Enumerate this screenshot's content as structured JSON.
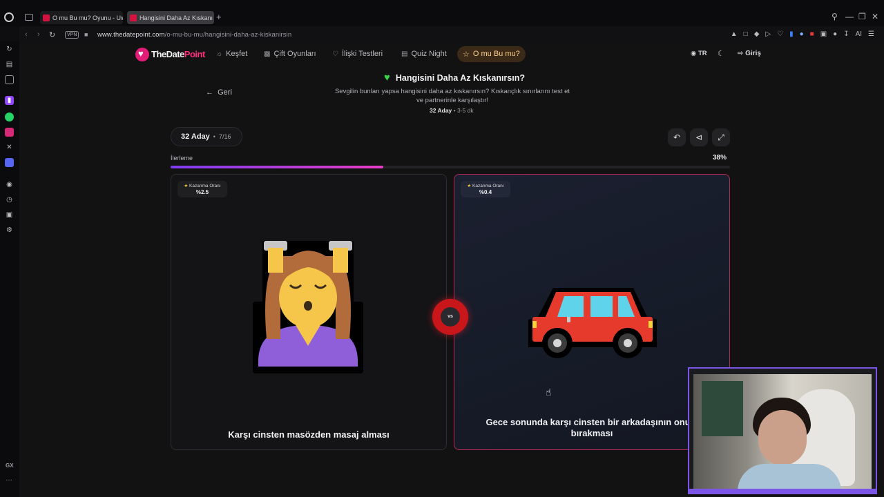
{
  "browser": {
    "tabs": [
      {
        "title": "O mu Bu mu? Oyunu - Uw",
        "active": false
      },
      {
        "title": "Hangisini Daha Az Kıskanı",
        "active": true
      }
    ],
    "url_domain": "www.thedatepoint.com",
    "url_path": "/o-mu-bu-mu/hangisini-daha-az-kiskanirsin",
    "vpn_label": "VPN",
    "ai_label": "AI",
    "gx_label": "GX"
  },
  "site": {
    "logo_part1": "TheDate",
    "logo_part2": "Point",
    "nav": [
      {
        "label": "Keşfet",
        "icon": "compass-icon"
      },
      {
        "label": "Çift Oyunları",
        "icon": "gamepad-icon"
      },
      {
        "label": "İlişki Testleri",
        "icon": "heart-outline-icon"
      },
      {
        "label": "Quiz Night",
        "icon": "book-icon"
      }
    ],
    "nav_active": {
      "label": "O mu Bu mu?",
      "icon": "trophy-icon"
    },
    "lang": "TR",
    "login": "Giriş"
  },
  "quiz": {
    "back": "Geri",
    "title": "Hangisini Daha Az Kıskanırsın?",
    "description": "Sevgilin bunları yapsa hangisini daha az kıskanırsın? Kıskançlık sınırlarını test et ve partnerinle karşılaştır!",
    "candidates": "32 Aday",
    "duration": "3-5 dk",
    "pill_main": "32 Aday",
    "pill_sub": "7/16",
    "progress_label": "İlerleme",
    "progress_text": "38%",
    "progress_value": 38
  },
  "cards": {
    "left": {
      "win_label": "Kazanma Oranı",
      "win_rate": "%2.5",
      "label": "Karşı cinsten masözden masaj alması",
      "image": "woman-getting-massage-emoji"
    },
    "right": {
      "win_label": "Kazanma Oranı",
      "win_rate": "%0.4",
      "label": "Gece sonunda karşı cinsten bir arkadaşının onu e bırakması",
      "image": "red-car-emoji"
    },
    "vs": "vs"
  },
  "colors": {
    "brand_pink": "#ff2e7a",
    "progress_start": "#7d3cf0",
    "progress_end": "#e83cc6",
    "vs_red": "#c8161b",
    "active_nav_bg": "#3b2a17"
  }
}
